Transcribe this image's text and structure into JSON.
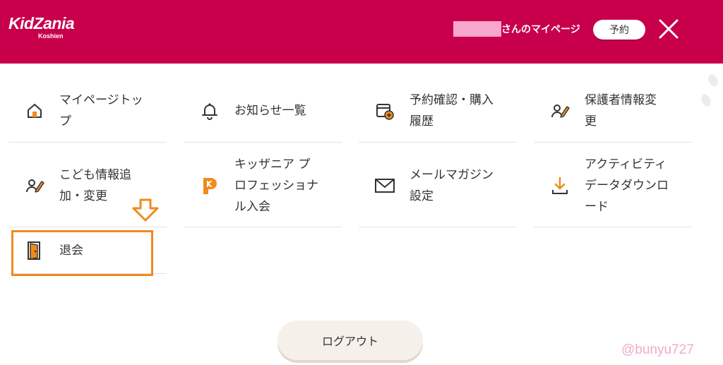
{
  "header": {
    "logo_main": "KidZania",
    "logo_sub": "Koshien",
    "user_suffix": "さんのマイページ",
    "reserve_label": "予約",
    "brand_color": "#c8004c"
  },
  "menu": {
    "items": [
      {
        "label": "マイページトッ\nプ",
        "icon": "home-icon"
      },
      {
        "label": "お知らせ一覧",
        "icon": "bell-icon"
      },
      {
        "label": "予約確認・購入\n履歴",
        "icon": "calendar-add-icon"
      },
      {
        "label": "保護者情報変\n更",
        "icon": "user-edit-icon"
      },
      {
        "label": "こども情報追\n加・変更",
        "icon": "user-edit-icon"
      },
      {
        "label": "キッザニア プ\nロフェッショナ\nル入会",
        "icon": "kidzania-pro-icon"
      },
      {
        "label": "メールマガジン\n設定",
        "icon": "mail-icon"
      },
      {
        "label": "アクティビティ\nデータダウンロ\nード",
        "icon": "download-icon"
      },
      {
        "label": "退会",
        "icon": "door-exit-icon"
      }
    ]
  },
  "highlight_color": "#f28a1e",
  "logout_label": "ログアウト",
  "watermark": "@bunyu727"
}
